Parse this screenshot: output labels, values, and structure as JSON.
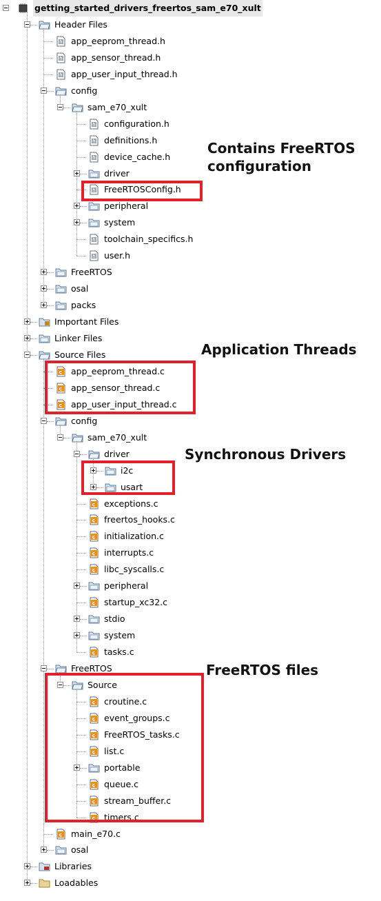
{
  "colors": {
    "highlight": "#e0202a",
    "folder": "#5f7f9f",
    "c_file": "#e8901a"
  },
  "nodes": [
    {
      "label": "getting_started_drivers_freertos_sam_e70_xult",
      "depth": 0,
      "icon": "chip-icon",
      "toggle": "minus"
    },
    {
      "label": "Header Files",
      "depth": 1,
      "icon": "folder-open-icon",
      "toggle": "minus"
    },
    {
      "label": "app_eeprom_thread.h",
      "depth": 2,
      "icon": "header-file-icon"
    },
    {
      "label": "app_sensor_thread.h",
      "depth": 2,
      "icon": "header-file-icon"
    },
    {
      "label": "app_user_input_thread.h",
      "depth": 2,
      "icon": "header-file-icon"
    },
    {
      "label": "config",
      "depth": 2,
      "icon": "folder-open-icon",
      "toggle": "minus"
    },
    {
      "label": "sam_e70_xult",
      "depth": 3,
      "icon": "folder-open-icon",
      "toggle": "minus"
    },
    {
      "label": "configuration.h",
      "depth": 4,
      "icon": "header-file-icon"
    },
    {
      "label": "definitions.h",
      "depth": 4,
      "icon": "header-file-icon"
    },
    {
      "label": "device_cache.h",
      "depth": 4,
      "icon": "header-file-icon"
    },
    {
      "label": "driver",
      "depth": 4,
      "icon": "folder-icon",
      "toggle": "plus"
    },
    {
      "label": "FreeRTOSConfig.h",
      "depth": 4,
      "icon": "header-file-icon"
    },
    {
      "label": "peripheral",
      "depth": 4,
      "icon": "folder-icon",
      "toggle": "plus"
    },
    {
      "label": "system",
      "depth": 4,
      "icon": "folder-icon",
      "toggle": "plus"
    },
    {
      "label": "toolchain_specifics.h",
      "depth": 4,
      "icon": "header-file-icon"
    },
    {
      "label": "user.h",
      "depth": 4,
      "icon": "header-file-icon"
    },
    {
      "label": "FreeRTOS",
      "depth": 2,
      "icon": "folder-icon",
      "toggle": "plus"
    },
    {
      "label": "osal",
      "depth": 2,
      "icon": "folder-icon",
      "toggle": "plus"
    },
    {
      "label": "packs",
      "depth": 2,
      "icon": "folder-icon",
      "toggle": "plus"
    },
    {
      "label": "Important Files",
      "depth": 1,
      "icon": "important-folder-icon",
      "toggle": "plus"
    },
    {
      "label": "Linker Files",
      "depth": 1,
      "icon": "folder-icon",
      "toggle": "plus"
    },
    {
      "label": "Source Files",
      "depth": 1,
      "icon": "folder-open-icon",
      "toggle": "minus"
    },
    {
      "label": "app_eeprom_thread.c",
      "depth": 2,
      "icon": "c-file-icon"
    },
    {
      "label": "app_sensor_thread.c",
      "depth": 2,
      "icon": "c-file-icon"
    },
    {
      "label": "app_user_input_thread.c",
      "depth": 2,
      "icon": "c-file-icon"
    },
    {
      "label": "config",
      "depth": 2,
      "icon": "folder-open-icon",
      "toggle": "minus"
    },
    {
      "label": "sam_e70_xult",
      "depth": 3,
      "icon": "folder-open-icon",
      "toggle": "minus"
    },
    {
      "label": "driver",
      "depth": 4,
      "icon": "folder-open-icon",
      "toggle": "minus"
    },
    {
      "label": "i2c",
      "depth": 5,
      "icon": "folder-icon",
      "toggle": "plus"
    },
    {
      "label": "usart",
      "depth": 5,
      "icon": "folder-icon",
      "toggle": "plus"
    },
    {
      "label": "exceptions.c",
      "depth": 4,
      "icon": "c-file-icon"
    },
    {
      "label": "freertos_hooks.c",
      "depth": 4,
      "icon": "c-file-icon"
    },
    {
      "label": "initialization.c",
      "depth": 4,
      "icon": "c-file-icon"
    },
    {
      "label": "interrupts.c",
      "depth": 4,
      "icon": "c-file-icon"
    },
    {
      "label": "libc_syscalls.c",
      "depth": 4,
      "icon": "c-file-icon"
    },
    {
      "label": "peripheral",
      "depth": 4,
      "icon": "folder-icon",
      "toggle": "plus"
    },
    {
      "label": "startup_xc32.c",
      "depth": 4,
      "icon": "c-file-icon"
    },
    {
      "label": "stdio",
      "depth": 4,
      "icon": "folder-icon",
      "toggle": "plus"
    },
    {
      "label": "system",
      "depth": 4,
      "icon": "folder-icon",
      "toggle": "plus"
    },
    {
      "label": "tasks.c",
      "depth": 4,
      "icon": "c-file-icon"
    },
    {
      "label": "FreeRTOS",
      "depth": 2,
      "icon": "folder-open-icon",
      "toggle": "minus"
    },
    {
      "label": "Source",
      "depth": 3,
      "icon": "folder-open-icon",
      "toggle": "minus"
    },
    {
      "label": "croutine.c",
      "depth": 4,
      "icon": "c-file-icon"
    },
    {
      "label": "event_groups.c",
      "depth": 4,
      "icon": "c-file-icon"
    },
    {
      "label": "FreeRTOS_tasks.c",
      "depth": 4,
      "icon": "c-file-icon"
    },
    {
      "label": "list.c",
      "depth": 4,
      "icon": "c-file-icon"
    },
    {
      "label": "portable",
      "depth": 4,
      "icon": "folder-icon",
      "toggle": "plus"
    },
    {
      "label": "queue.c",
      "depth": 4,
      "icon": "c-file-icon"
    },
    {
      "label": "stream_buffer.c",
      "depth": 4,
      "icon": "c-file-icon"
    },
    {
      "label": "timers.c",
      "depth": 4,
      "icon": "c-file-icon"
    },
    {
      "label": "main_e70.c",
      "depth": 2,
      "icon": "c-file-icon"
    },
    {
      "label": "osal",
      "depth": 2,
      "icon": "folder-icon",
      "toggle": "plus"
    },
    {
      "label": "Libraries",
      "depth": 1,
      "icon": "libraries-folder-icon",
      "toggle": "plus"
    },
    {
      "label": "Loadables",
      "depth": 1,
      "icon": "loadables-folder-icon",
      "toggle": "plus"
    }
  ],
  "annotations": {
    "config": "Contains FreeRTOS\nconfiguration",
    "threads": "Application Threads",
    "drivers": "Synchronous Drivers",
    "freertos": "FreeRTOS files"
  }
}
